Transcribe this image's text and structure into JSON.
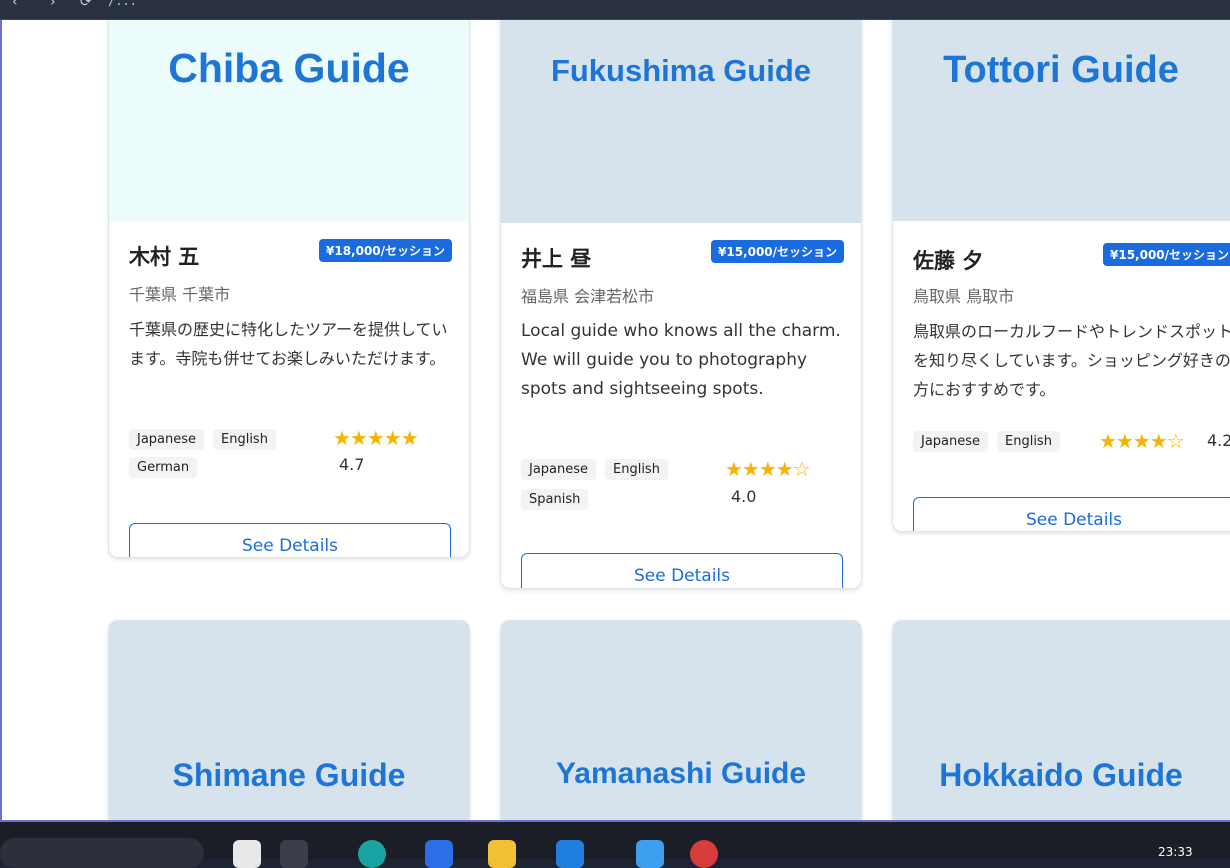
{
  "browser": {
    "url": "/...",
    "back_glyph": "‹",
    "forward_glyph": "›",
    "reload_glyph": "⟳"
  },
  "cards": [
    {
      "title": "Chiba Guide",
      "name": "木村 五",
      "price": "¥18,000/セッション",
      "location": "千葉県 千葉市",
      "description": "千葉県の歴史に特化したツアーを提供しています。寺院も併せてお楽しみいただけます。",
      "languages": [
        "Japanese",
        "English",
        "German"
      ],
      "stars": "★★★★★",
      "rating": "4.7",
      "button": "See Details"
    },
    {
      "title": "Fukushima Guide",
      "name": "井上 昼",
      "price": "¥15,000/セッション",
      "location": "福島県 会津若松市",
      "description": "Local guide who knows all the charm. We will guide you to photography spots and sightseeing spots.",
      "languages": [
        "Japanese",
        "English",
        "Spanish"
      ],
      "stars": "★★★★☆",
      "rating": "4.0",
      "button": "See Details"
    },
    {
      "title": "Tottori Guide",
      "name": "佐藤 夕",
      "price": "¥15,000/セッション",
      "location": "鳥取県 鳥取市",
      "description": "鳥取県のローカルフードやトレンドスポットを知り尽くしています。ショッピング好きの方におすすめです。",
      "languages": [
        "Japanese",
        "English"
      ],
      "stars": "★★★★☆",
      "rating": "4.2",
      "button": "See Details"
    },
    {
      "title": "Shimane Guide"
    },
    {
      "title": "Yamanashi Guide"
    },
    {
      "title": "Hokkaido Guide"
    }
  ],
  "taskbar": {
    "clock": "23:33"
  }
}
